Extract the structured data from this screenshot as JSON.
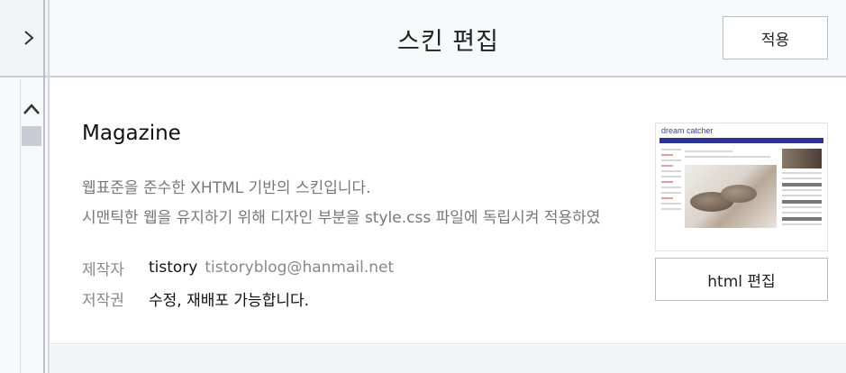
{
  "header": {
    "title": "스킨 편집",
    "apply_label": "적용"
  },
  "sidebar": {
    "expand_icon": "chevron-right-icon",
    "scroll_up_icon": "chevron-up-icon"
  },
  "skin": {
    "name": "Magazine",
    "description_line1": "웹표준을 준수한 XHTML 기반의 스킨입니다.",
    "description_line2": "시맨틱한 웹을 유지하기 위해 디자인 부분을 style.css 파일에 독립시켜 적용하였",
    "author_label": "제작자",
    "author_name": "tistory",
    "author_email": "tistoryblog@hanmail.net",
    "license_label": "저작권",
    "license_text": "수정, 재배포 가능합니다.",
    "html_edit_label": "html 편집",
    "thumbnail": {
      "logo_text": "dream catcher",
      "nav_color": "#2d3390"
    }
  }
}
